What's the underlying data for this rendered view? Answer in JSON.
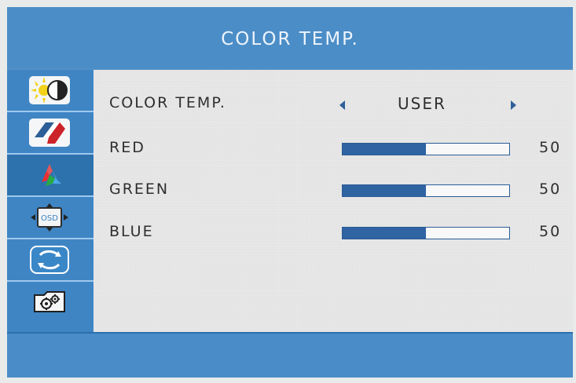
{
  "header": {
    "title": "COLOR TEMP."
  },
  "sidebar": {
    "items": [
      {
        "icon": "brightness-contrast-icon",
        "active": false
      },
      {
        "icon": "geometry-icon",
        "active": false
      },
      {
        "icon": "color-icon",
        "active": true
      },
      {
        "icon": "osd-icon",
        "active": false
      },
      {
        "icon": "reset-icon",
        "active": false
      },
      {
        "icon": "settings-icon",
        "active": false
      }
    ]
  },
  "menu": {
    "color_temp": {
      "label": "COLOR TEMP.",
      "value": "USER"
    },
    "red": {
      "label": "RED",
      "value": "50",
      "level_fraction": 0.5
    },
    "green": {
      "label": "GREEN",
      "value": "50",
      "level_fraction": 0.5
    },
    "blue": {
      "label": "BLUE",
      "value": "50",
      "level_fraction": 0.5
    }
  },
  "colors": {
    "frame": "#4a8cc6",
    "panel": "#e7e7e7",
    "bar_fill": "#2f63a2",
    "bar_border": "#2a5c96",
    "text": "#2f2f2f",
    "title_text": "#eef4fb"
  }
}
